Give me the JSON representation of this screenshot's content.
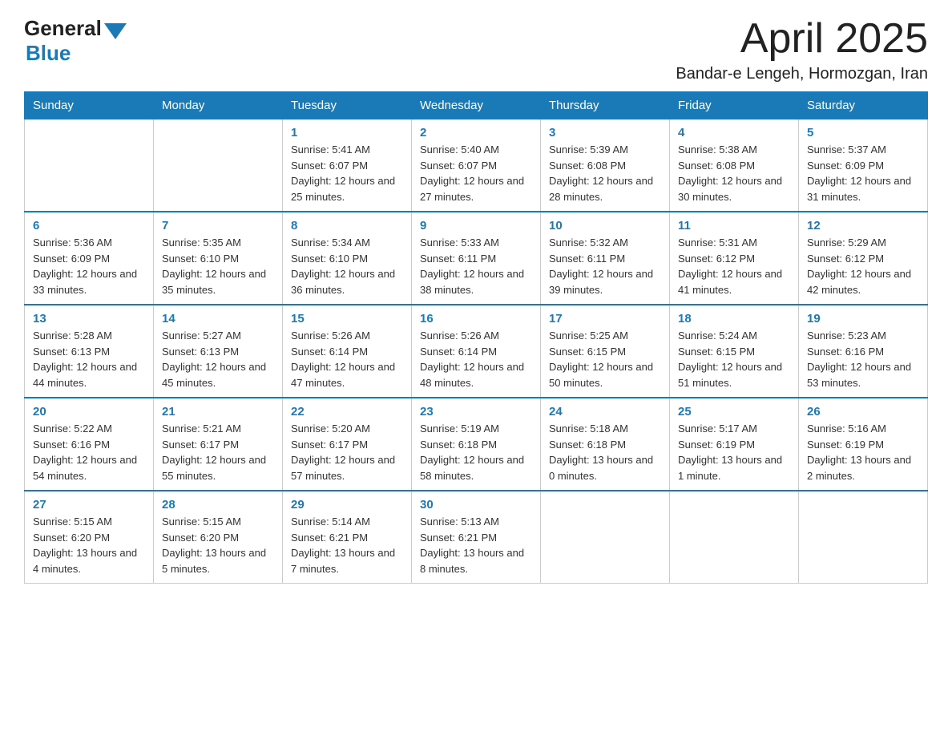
{
  "header": {
    "logo_general": "General",
    "logo_blue": "Blue",
    "month_title": "April 2025",
    "location": "Bandar-e Lengeh, Hormozgan, Iran"
  },
  "days_of_week": [
    "Sunday",
    "Monday",
    "Tuesday",
    "Wednesday",
    "Thursday",
    "Friday",
    "Saturday"
  ],
  "weeks": [
    [
      {
        "day": "",
        "sunrise": "",
        "sunset": "",
        "daylight": ""
      },
      {
        "day": "",
        "sunrise": "",
        "sunset": "",
        "daylight": ""
      },
      {
        "day": "1",
        "sunrise": "Sunrise: 5:41 AM",
        "sunset": "Sunset: 6:07 PM",
        "daylight": "Daylight: 12 hours and 25 minutes."
      },
      {
        "day": "2",
        "sunrise": "Sunrise: 5:40 AM",
        "sunset": "Sunset: 6:07 PM",
        "daylight": "Daylight: 12 hours and 27 minutes."
      },
      {
        "day": "3",
        "sunrise": "Sunrise: 5:39 AM",
        "sunset": "Sunset: 6:08 PM",
        "daylight": "Daylight: 12 hours and 28 minutes."
      },
      {
        "day": "4",
        "sunrise": "Sunrise: 5:38 AM",
        "sunset": "Sunset: 6:08 PM",
        "daylight": "Daylight: 12 hours and 30 minutes."
      },
      {
        "day": "5",
        "sunrise": "Sunrise: 5:37 AM",
        "sunset": "Sunset: 6:09 PM",
        "daylight": "Daylight: 12 hours and 31 minutes."
      }
    ],
    [
      {
        "day": "6",
        "sunrise": "Sunrise: 5:36 AM",
        "sunset": "Sunset: 6:09 PM",
        "daylight": "Daylight: 12 hours and 33 minutes."
      },
      {
        "day": "7",
        "sunrise": "Sunrise: 5:35 AM",
        "sunset": "Sunset: 6:10 PM",
        "daylight": "Daylight: 12 hours and 35 minutes."
      },
      {
        "day": "8",
        "sunrise": "Sunrise: 5:34 AM",
        "sunset": "Sunset: 6:10 PM",
        "daylight": "Daylight: 12 hours and 36 minutes."
      },
      {
        "day": "9",
        "sunrise": "Sunrise: 5:33 AM",
        "sunset": "Sunset: 6:11 PM",
        "daylight": "Daylight: 12 hours and 38 minutes."
      },
      {
        "day": "10",
        "sunrise": "Sunrise: 5:32 AM",
        "sunset": "Sunset: 6:11 PM",
        "daylight": "Daylight: 12 hours and 39 minutes."
      },
      {
        "day": "11",
        "sunrise": "Sunrise: 5:31 AM",
        "sunset": "Sunset: 6:12 PM",
        "daylight": "Daylight: 12 hours and 41 minutes."
      },
      {
        "day": "12",
        "sunrise": "Sunrise: 5:29 AM",
        "sunset": "Sunset: 6:12 PM",
        "daylight": "Daylight: 12 hours and 42 minutes."
      }
    ],
    [
      {
        "day": "13",
        "sunrise": "Sunrise: 5:28 AM",
        "sunset": "Sunset: 6:13 PM",
        "daylight": "Daylight: 12 hours and 44 minutes."
      },
      {
        "day": "14",
        "sunrise": "Sunrise: 5:27 AM",
        "sunset": "Sunset: 6:13 PM",
        "daylight": "Daylight: 12 hours and 45 minutes."
      },
      {
        "day": "15",
        "sunrise": "Sunrise: 5:26 AM",
        "sunset": "Sunset: 6:14 PM",
        "daylight": "Daylight: 12 hours and 47 minutes."
      },
      {
        "day": "16",
        "sunrise": "Sunrise: 5:26 AM",
        "sunset": "Sunset: 6:14 PM",
        "daylight": "Daylight: 12 hours and 48 minutes."
      },
      {
        "day": "17",
        "sunrise": "Sunrise: 5:25 AM",
        "sunset": "Sunset: 6:15 PM",
        "daylight": "Daylight: 12 hours and 50 minutes."
      },
      {
        "day": "18",
        "sunrise": "Sunrise: 5:24 AM",
        "sunset": "Sunset: 6:15 PM",
        "daylight": "Daylight: 12 hours and 51 minutes."
      },
      {
        "day": "19",
        "sunrise": "Sunrise: 5:23 AM",
        "sunset": "Sunset: 6:16 PM",
        "daylight": "Daylight: 12 hours and 53 minutes."
      }
    ],
    [
      {
        "day": "20",
        "sunrise": "Sunrise: 5:22 AM",
        "sunset": "Sunset: 6:16 PM",
        "daylight": "Daylight: 12 hours and 54 minutes."
      },
      {
        "day": "21",
        "sunrise": "Sunrise: 5:21 AM",
        "sunset": "Sunset: 6:17 PM",
        "daylight": "Daylight: 12 hours and 55 minutes."
      },
      {
        "day": "22",
        "sunrise": "Sunrise: 5:20 AM",
        "sunset": "Sunset: 6:17 PM",
        "daylight": "Daylight: 12 hours and 57 minutes."
      },
      {
        "day": "23",
        "sunrise": "Sunrise: 5:19 AM",
        "sunset": "Sunset: 6:18 PM",
        "daylight": "Daylight: 12 hours and 58 minutes."
      },
      {
        "day": "24",
        "sunrise": "Sunrise: 5:18 AM",
        "sunset": "Sunset: 6:18 PM",
        "daylight": "Daylight: 13 hours and 0 minutes."
      },
      {
        "day": "25",
        "sunrise": "Sunrise: 5:17 AM",
        "sunset": "Sunset: 6:19 PM",
        "daylight": "Daylight: 13 hours and 1 minute."
      },
      {
        "day": "26",
        "sunrise": "Sunrise: 5:16 AM",
        "sunset": "Sunset: 6:19 PM",
        "daylight": "Daylight: 13 hours and 2 minutes."
      }
    ],
    [
      {
        "day": "27",
        "sunrise": "Sunrise: 5:15 AM",
        "sunset": "Sunset: 6:20 PM",
        "daylight": "Daylight: 13 hours and 4 minutes."
      },
      {
        "day": "28",
        "sunrise": "Sunrise: 5:15 AM",
        "sunset": "Sunset: 6:20 PM",
        "daylight": "Daylight: 13 hours and 5 minutes."
      },
      {
        "day": "29",
        "sunrise": "Sunrise: 5:14 AM",
        "sunset": "Sunset: 6:21 PM",
        "daylight": "Daylight: 13 hours and 7 minutes."
      },
      {
        "day": "30",
        "sunrise": "Sunrise: 5:13 AM",
        "sunset": "Sunset: 6:21 PM",
        "daylight": "Daylight: 13 hours and 8 minutes."
      },
      {
        "day": "",
        "sunrise": "",
        "sunset": "",
        "daylight": ""
      },
      {
        "day": "",
        "sunrise": "",
        "sunset": "",
        "daylight": ""
      },
      {
        "day": "",
        "sunrise": "",
        "sunset": "",
        "daylight": ""
      }
    ]
  ]
}
